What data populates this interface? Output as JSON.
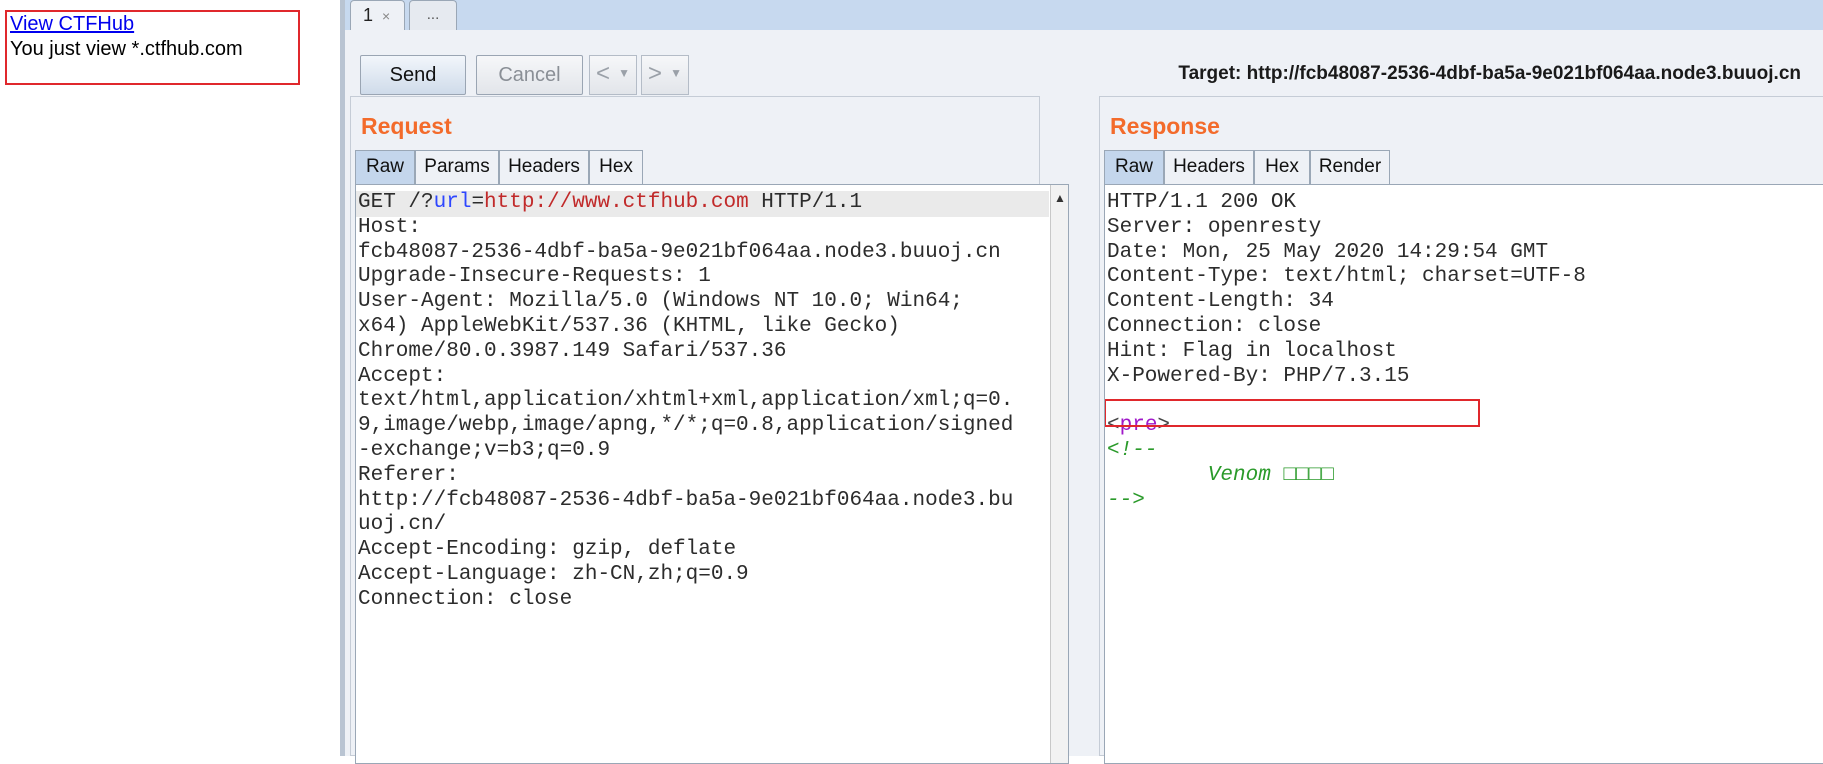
{
  "browser": {
    "link_text": "View CTFHub",
    "body_text": "You just view *.ctfhub.com"
  },
  "burp": {
    "tabs": [
      {
        "label": "1",
        "close": "×"
      },
      {
        "label": "..."
      }
    ],
    "toolbar": {
      "send_label": "Send",
      "cancel_label": "Cancel",
      "back_glyph": "<",
      "forward_glyph": ">",
      "dropdown_glyph": "▼",
      "target": "Target: http://fcb48087-2536-4dbf-ba5a-9e021bf064aa.node3.buuoj.cn"
    },
    "request": {
      "title": "Request",
      "tabs": [
        "Raw",
        "Params",
        "Headers",
        "Hex"
      ],
      "active_tab": "Raw",
      "line1": {
        "prefix": "GET /?",
        "param": "url",
        "eq": "=",
        "value": "http://www.ctfhub.com",
        "suffix": " HTTP/1.1"
      },
      "lines": [
        "Host:",
        "fcb48087-2536-4dbf-ba5a-9e021bf064aa.node3.buuoj.cn",
        "Upgrade-Insecure-Requests: 1",
        "User-Agent: Mozilla/5.0 (Windows NT 10.0; Win64;",
        "x64) AppleWebKit/537.36 (KHTML, like Gecko)",
        "Chrome/80.0.3987.149 Safari/537.36",
        "Accept:",
        "text/html,application/xhtml+xml,application/xml;q=0.",
        "9,image/webp,image/apng,*/*;q=0.8,application/signed",
        "-exchange;v=b3;q=0.9",
        "Referer:",
        "http://fcb48087-2536-4dbf-ba5a-9e021bf064aa.node3.bu",
        "uoj.cn/",
        "Accept-Encoding: gzip, deflate",
        "Accept-Language: zh-CN,zh;q=0.9",
        "Connection: close"
      ]
    },
    "response": {
      "title": "Response",
      "tabs": [
        "Raw",
        "Headers",
        "Hex",
        "Render"
      ],
      "active_tab": "Raw",
      "lines": [
        "HTTP/1.1 200 OK",
        "Server: openresty",
        "Date: Mon, 25 May 2020 14:29:54 GMT",
        "Content-Type: text/html; charset=UTF-8",
        "Content-Length: 34",
        "Connection: close",
        "Hint: Flag in localhost",
        "X-Powered-By: PHP/7.3.15"
      ],
      "body": {
        "tag_open": "<",
        "tag_name": "pre",
        "tag_close": ">",
        "comment_open": "<!--",
        "venom": "Venom □□□□",
        "comment_close": "-->"
      }
    }
  }
}
